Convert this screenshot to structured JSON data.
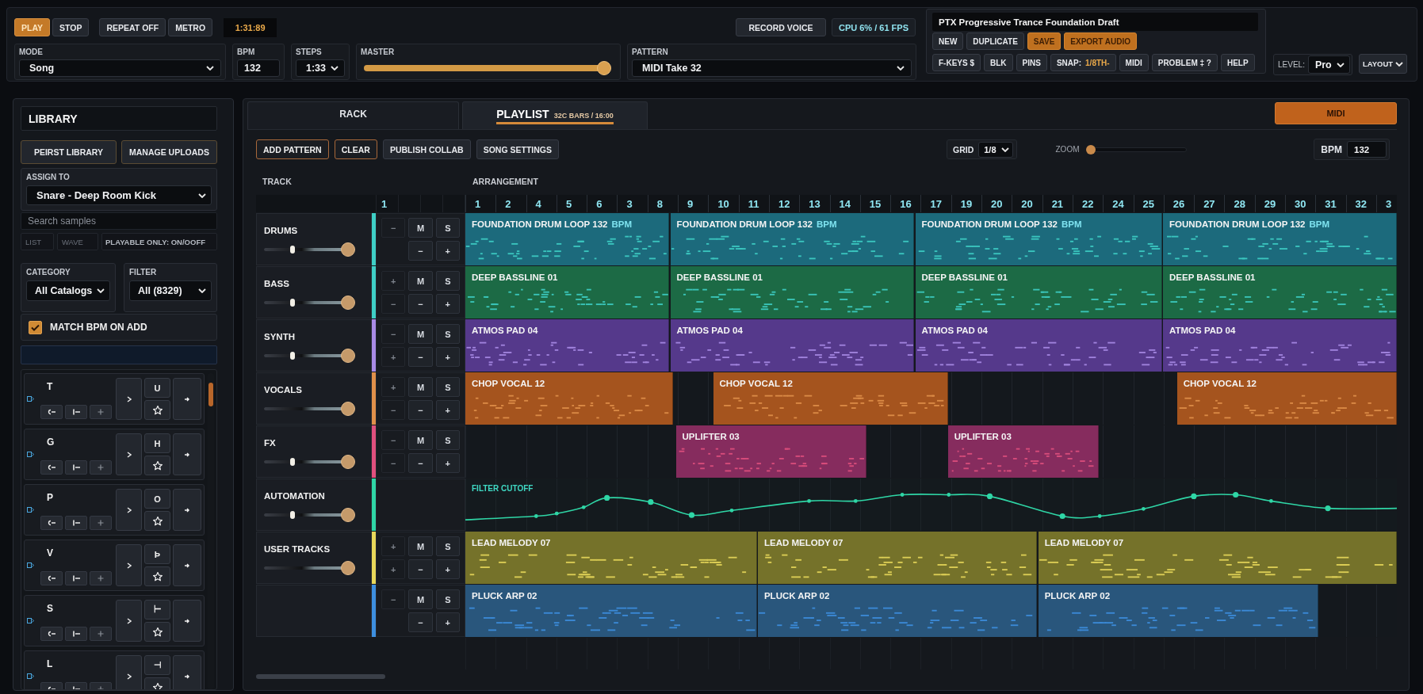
{
  "top_bar": {
    "transport": [
      {
        "label": "PLAY",
        "active": true
      },
      {
        "label": "STOP",
        "active": false
      }
    ],
    "toggles": [
      "REPEAT OFF",
      "METRO"
    ],
    "clock": "1:31:89",
    "record_button": "RECORD VOICE",
    "cpu": "CPU 6% / 61 FPS",
    "fields": [
      {
        "kind": "select",
        "label": "MODE",
        "value": "Song"
      },
      {
        "kind": "number",
        "label": "BPM",
        "value": "132"
      },
      {
        "kind": "select",
        "label": "STEPS",
        "value": "1:33"
      },
      {
        "kind": "slider",
        "label": "MASTER",
        "level": 0.98
      },
      {
        "kind": "select",
        "label": "PATTERN",
        "value": "MIDI Take 32"
      }
    ]
  },
  "project": {
    "title": "PTX Progressive Trance Foundation Draft",
    "actions": [
      {
        "label": "NEW",
        "accent": false
      },
      {
        "label": "DUPLICATE",
        "accent": false
      },
      {
        "label": "SAVE",
        "accent": true
      },
      {
        "label": "EXPORT AUDIO",
        "accent": true
      }
    ],
    "tools": [
      {
        "label": "F-KEYS $"
      },
      {
        "label": "BLK"
      },
      {
        "label": "PINS"
      },
      {
        "label": "SNAP:",
        "value": "1/8TH-"
      },
      {
        "label": "MIDI"
      },
      {
        "label": "PROBLEM ‡ ?"
      },
      {
        "label": "HELP"
      }
    ]
  },
  "level": {
    "label": "LEVEL:",
    "value": "Pro"
  },
  "layout_button": "LAYOUT",
  "library": {
    "title": "LIBRARY",
    "buttons": [
      "PEIRST LIBRARY",
      "MANAGE UPLOADS"
    ],
    "assign": {
      "label": "ASSIGN TO",
      "value": "Snare - Deep Room Kick"
    },
    "search": {
      "placeholder": "Search samples"
    },
    "view_tabs": [
      {
        "label": "LIST",
        "selected": false
      },
      {
        "label": "WAVE",
        "selected": false
      }
    ],
    "playable_toggle": "PLAYABLE ONLY: ON/OOFF",
    "category": {
      "label": "CATEGORY",
      "value": "All Catalogs"
    },
    "filter": {
      "label": "FILTER",
      "value": "All (8329)"
    },
    "match_bpm": {
      "label": "MATCH BPM ON ADD",
      "checked": true
    },
    "pads": [
      {
        "key": "T",
        "alt_key": "U"
      },
      {
        "key": "G",
        "alt_key": "H"
      },
      {
        "key": "P",
        "alt_key": "O"
      },
      {
        "key": "V",
        "alt_key": "Þ"
      },
      {
        "key": "S",
        "alt_key": "⊢"
      },
      {
        "key": "L",
        "alt_key": "⊣"
      }
    ]
  },
  "playlist": {
    "tabs": [
      {
        "label": "RACK",
        "selected": false
      },
      {
        "label": "PLAYLIST",
        "subtitle": "32C BARS / 16:00",
        "selected": true
      }
    ],
    "midi_button": "MIDI",
    "toolbar": [
      {
        "label": "ADD PATTERN",
        "accent": true
      },
      {
        "label": "CLEAR",
        "accent": true
      },
      {
        "label": "PUBLISH COLLAB",
        "accent": false
      },
      {
        "label": "SONG SETTINGS",
        "accent": false
      }
    ],
    "grid": {
      "label": "GRID",
      "value": "1/8"
    },
    "zoom": {
      "label": "ZOOM",
      "level": 0
    },
    "bpm": {
      "label": "BPM",
      "value": "132"
    },
    "headers": [
      "TRACK",
      "ARRANGEMENT"
    ],
    "mixer_ruler": "1",
    "ruler": [
      "1",
      "2",
      "4",
      "5",
      "6",
      "3",
      "8",
      "9",
      "10",
      "11",
      "12",
      "13",
      "14",
      "15",
      "16",
      "17",
      "19",
      "20",
      "20",
      "21",
      "22",
      "24",
      "25",
      "26",
      "27",
      "28",
      "29",
      "30",
      "31",
      "32",
      "3"
    ],
    "tracks": [
      {
        "kind": "clips",
        "name": "DRUMS",
        "color": "#3ecfc6",
        "pan": {
          "level": 0.32
        },
        "volume": {
          "level": 0.95
        },
        "buttons": [
          "−",
          "M",
          "S"
        ],
        "sub_buttons": [
          "−",
          "+"
        ],
        "clips": [
          {
            "label": "FOUNDATION DRUM LOOP 132",
            "tag": "BPM",
            "color": "#1c6a7c"
          },
          {
            "label": "FOUNDATION DRUM LOOP 132",
            "tag": "BPM",
            "color": "#1c6a7c"
          },
          {
            "label": "FOUNDATION DRUM LOOP 132",
            "tag": "BPM",
            "color": "#1c6a7c"
          },
          {
            "label": "FOUNDATION DRUM LOOP 132",
            "tag": "BPM",
            "color": "#1c6a7c"
          }
        ]
      },
      {
        "kind": "clips",
        "name": "BASS",
        "color": "#3ecfc6",
        "pan": {
          "level": 0.32
        },
        "volume": {
          "level": 0.95
        },
        "buttons": [
          "+",
          "M",
          "S"
        ],
        "sub_buttons": [
          "−",
          "−",
          "+"
        ],
        "clips": [
          {
            "label": "DEEP BASSLINE 01",
            "color": "#1c6a45"
          },
          {
            "label": "DEEP BASSLINE 01",
            "color": "#1c6a45"
          },
          {
            "label": "DEEP BASSLINE 01",
            "color": "#1c6a45"
          },
          {
            "label": "DEEP BASSLINE 01",
            "color": "#1c6a45"
          }
        ]
      },
      {
        "kind": "clips",
        "name": "SYNTH",
        "color": "#a98be6",
        "pan": {
          "level": 0.32
        },
        "volume": {
          "level": 0.95
        },
        "buttons": [
          "−",
          "M",
          "S"
        ],
        "sub_buttons": [
          "+",
          "−",
          "+"
        ],
        "clips": [
          {
            "label": "ATMOS PAD 04",
            "color": "#55398b"
          },
          {
            "label": "ATMOS PAD 04",
            "color": "#55398b"
          },
          {
            "label": "ATMOS PAD 04",
            "color": "#55398b"
          },
          {
            "label": "ATMOS PAD 04",
            "color": "#55398b"
          }
        ]
      },
      {
        "kind": "clips",
        "name": "VOCALS",
        "color": "#e0904a",
        "volume": {
          "level": 0.95
        },
        "buttons": [
          "+",
          "M",
          "S"
        ],
        "sub_buttons": [
          "−",
          "−",
          "+"
        ],
        "clips": [
          {
            "label": "CHOP VOCAL 12",
            "color": "#a5541e"
          },
          {
            "label": "CHOP VOCAL 12",
            "color": "#a5541e"
          },
          {
            "label": "CHOP VOCAL 12",
            "color": "#a5541e"
          }
        ]
      },
      {
        "kind": "clips",
        "name": "FX",
        "color": "#e0507e",
        "pan": {
          "level": 0.32
        },
        "volume": {
          "level": 0.95
        },
        "buttons": [
          "−",
          "M",
          "S"
        ],
        "sub_buttons": [
          "−",
          "−",
          "+"
        ],
        "clips": [
          {
            "label": "UPLIFTER 03",
            "color": "#862c5e"
          },
          {
            "label": "UPLIFTER 03",
            "color": "#862c5e"
          }
        ]
      },
      {
        "kind": "automation",
        "name": "AUTOMATION",
        "color": "#2fd6a6",
        "pan": {
          "level": 0.32
        },
        "volume": {
          "level": 0.95
        },
        "lane_label": "FILTER CUTOFF"
      },
      {
        "kind": "clips",
        "name": "USER TRACKS",
        "color": "#e8d85a",
        "volume": {
          "level": 0.95
        },
        "buttons": [
          "+",
          "M",
          "S"
        ],
        "sub_buttons": [
          "+",
          "−",
          "+"
        ],
        "clips": [
          {
            "label": "LEAD MELODY 07",
            "color": "#75722a"
          },
          {
            "label": "LEAD MELODY 07",
            "color": "#75722a"
          },
          {
            "label": "LEAD MELODY 07",
            "color": "#75722a"
          }
        ]
      },
      {
        "kind": "clips",
        "color": "#3d8fe0",
        "buttons": [
          "−",
          "M",
          "S"
        ],
        "sub_buttons": [
          "−",
          "+"
        ],
        "clips": [
          {
            "label": "PLUCK ARP 02",
            "color": "#29567c"
          },
          {
            "label": "PLUCK ARP 02",
            "color": "#29567c"
          },
          {
            "label": "PLUCK ARP 02",
            "color": "#29567c"
          }
        ]
      }
    ]
  }
}
